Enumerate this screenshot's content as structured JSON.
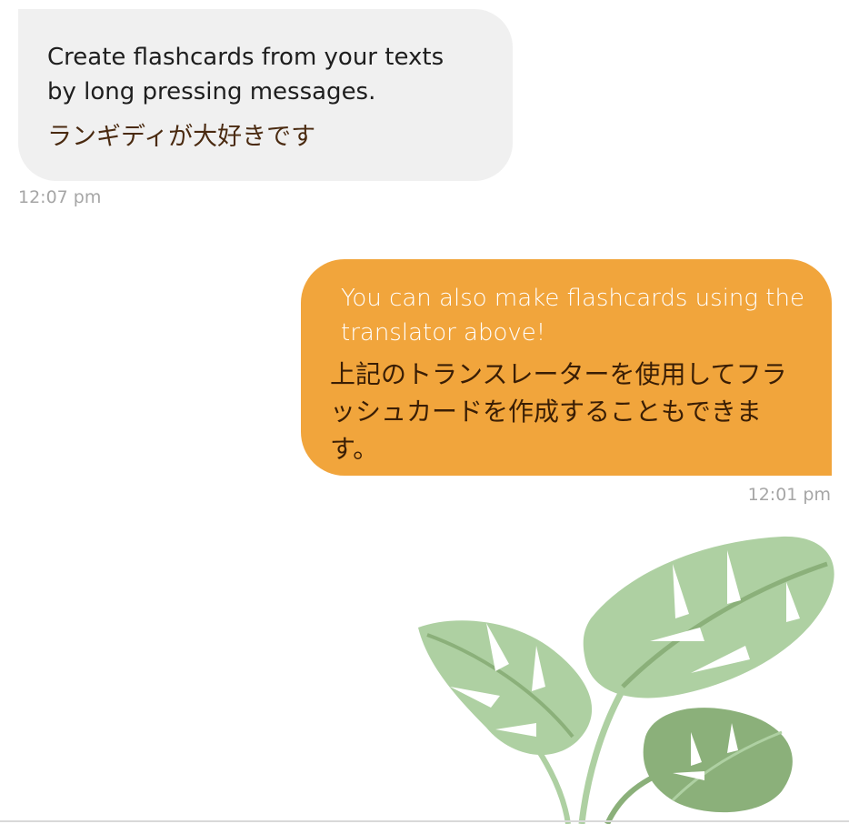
{
  "messages": [
    {
      "direction": "incoming",
      "text_en": "Create flashcards from your texts by long pressing messages.",
      "text_jp": "ランギディが大好きです",
      "time": "12:07 pm"
    },
    {
      "direction": "outgoing",
      "text_en": "You can also  make flashcards using the translator above!",
      "text_jp": "上記のトランスレーターを使用してフラッシュカードを作成することもできます。",
      "time": "12:01 pm"
    }
  ],
  "colors": {
    "incoming_bubble": "#f0f0f0",
    "outgoing_bubble": "#f1a53c",
    "timestamp": "#a6a6a6",
    "leaf_light": "#aed0a2",
    "leaf_dark": "#8bb07a"
  },
  "decoration": {
    "icon": "monstera-leaves-illustration"
  }
}
